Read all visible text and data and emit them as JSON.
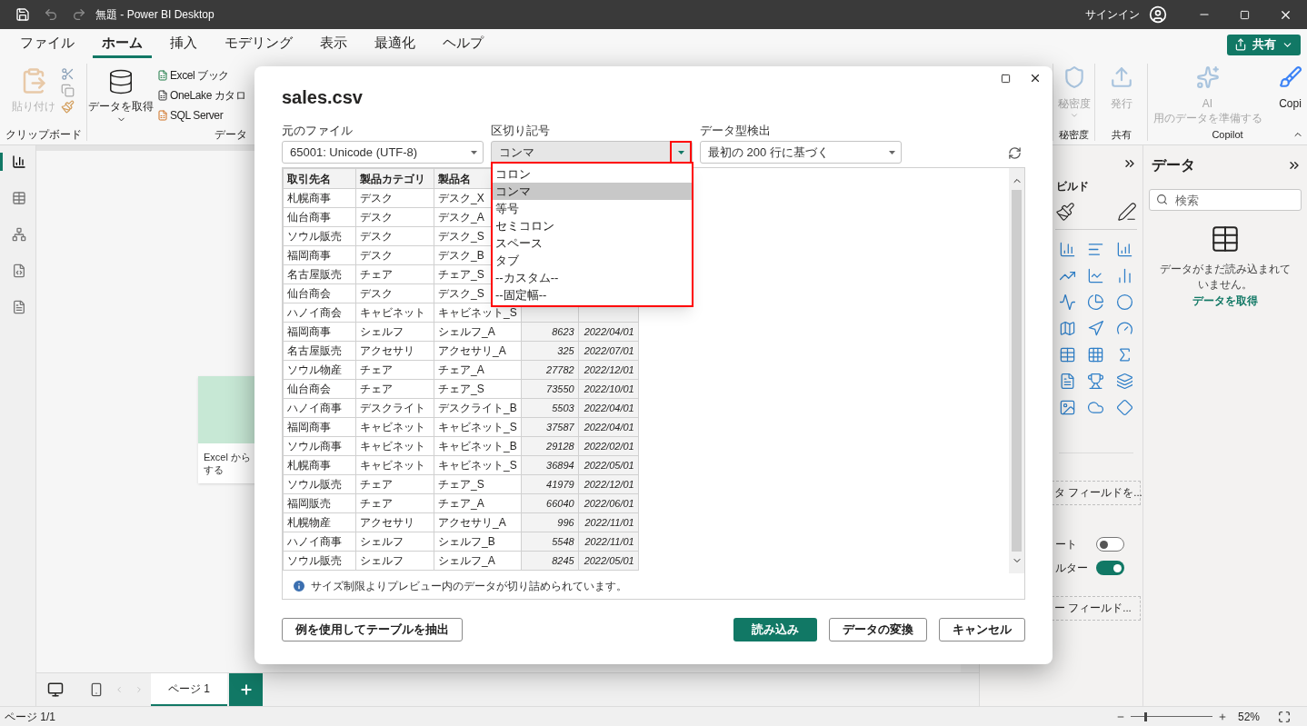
{
  "window": {
    "title": "無題 - Power BI Desktop",
    "signin": "サインイン"
  },
  "menu_tabs": [
    {
      "label": "ファイル",
      "selected": false
    },
    {
      "label": "ホーム",
      "selected": true
    },
    {
      "label": "挿入",
      "selected": false
    },
    {
      "label": "モデリング",
      "selected": false
    },
    {
      "label": "表示",
      "selected": false
    },
    {
      "label": "最適化",
      "selected": false
    },
    {
      "label": "ヘルプ",
      "selected": false
    }
  ],
  "share_button": "共有",
  "ribbon": {
    "clipboard": {
      "paste": "貼り付け",
      "paste_disabled": true,
      "group": "クリップボード"
    },
    "data": {
      "get_data": "データを取得",
      "sources": [
        "Excel ブック",
        "OneLake カタロ",
        "SQL Server"
      ],
      "group": "データ"
    },
    "right_groups": [
      {
        "label": "秘密度",
        "buttons": [
          {
            "label": "秘密度",
            "disabled": true
          }
        ]
      },
      {
        "label": "共有",
        "buttons": [
          {
            "label": "発行",
            "disabled": true
          }
        ]
      },
      {
        "label": "Copilot",
        "buttons": [
          {
            "label": "AI\n用のデータを準備する",
            "disabled": true
          },
          {
            "label": "Copi",
            "disabled": false
          }
        ]
      }
    ]
  },
  "nav": [
    {
      "kind": "report",
      "selected": true
    },
    {
      "kind": "table",
      "selected": false
    },
    {
      "kind": "model",
      "selected": false
    },
    {
      "kind": "dax",
      "selected": false
    },
    {
      "kind": "tmdl",
      "selected": false
    }
  ],
  "canvas": {
    "card_lines": [
      "Excel から",
      "する"
    ]
  },
  "pages": [
    {
      "label": "ページ 1",
      "selected": true
    }
  ],
  "status_bar": {
    "page": "ページ 1/1",
    "zoom": "52%",
    "zoom_slider": {
      "level": 0.17
    }
  },
  "visualizations": {
    "build_label": "ビルド",
    "field_well_1": "タ フィールドを...",
    "toggles": [
      {
        "label": "ート",
        "on": false
      },
      {
        "label": "ルター",
        "on": true
      }
    ],
    "field_well_2": "ー フィールド..."
  },
  "data_pane": {
    "title": "データ",
    "search_placeholder": "検索",
    "empty_message": "データがまだ読み込まれていません。",
    "link": "データを取得"
  },
  "dialog": {
    "title": "sales.csv",
    "file_origin": {
      "label": "元のファイル",
      "value": "65001: Unicode (UTF-8)"
    },
    "delimiter": {
      "label": "区切り記号",
      "value": "コンマ",
      "expanded": true,
      "highlighted": true,
      "options": [
        {
          "label": "コロン",
          "selected": false
        },
        {
          "label": "コンマ",
          "selected": true
        },
        {
          "label": "等号",
          "selected": false
        },
        {
          "label": "セミコロン",
          "selected": false
        },
        {
          "label": "スペース",
          "selected": false
        },
        {
          "label": "タブ",
          "selected": false
        },
        {
          "label": "--カスタム--",
          "selected": false
        },
        {
          "label": "--固定幅--",
          "selected": false
        }
      ]
    },
    "type_detection": {
      "label": "データ型検出",
      "value": "最初の 200 行に基づく"
    },
    "table": {
      "columns": [
        "取引先名",
        "製品カテゴリ",
        "製品名"
      ],
      "rows": [
        {
          "cells": [
            "札幌商事",
            "デスク",
            "デスク_X"
          ]
        },
        {
          "cells": [
            "仙台商事",
            "デスク",
            "デスク_A"
          ]
        },
        {
          "cells": [
            "ソウル販売",
            "デスク",
            "デスク_S"
          ]
        },
        {
          "cells": [
            "福岡商事",
            "デスク",
            "デスク_B"
          ]
        },
        {
          "cells": [
            "名古屋販売",
            "チェア",
            "チェア_S"
          ]
        },
        {
          "cells": [
            "仙台商会",
            "デスク",
            "デスク_S"
          ]
        },
        {
          "cells": [
            "ハノイ商会",
            "キャビネット",
            "キャビネット_S"
          ]
        },
        {
          "cells": [
            "福岡商事",
            "シェルフ",
            "シェルフ_A",
            "8623",
            "2022/04/01"
          ]
        },
        {
          "cells": [
            "名古屋販売",
            "アクセサリ",
            "アクセサリ_A",
            "325",
            "2022/07/01"
          ]
        },
        {
          "cells": [
            "ソウル物産",
            "チェア",
            "チェア_A",
            "27782",
            "2022/12/01"
          ]
        },
        {
          "cells": [
            "仙台商会",
            "チェア",
            "チェア_S",
            "73550",
            "2022/10/01"
          ]
        },
        {
          "cells": [
            "ハノイ商事",
            "デスクライト",
            "デスクライト_B",
            "5503",
            "2022/04/01"
          ]
        },
        {
          "cells": [
            "福岡商事",
            "キャビネット",
            "キャビネット_S",
            "37587",
            "2022/04/01"
          ]
        },
        {
          "cells": [
            "ソウル商事",
            "キャビネット",
            "キャビネット_B",
            "29128",
            "2022/02/01"
          ]
        },
        {
          "cells": [
            "札幌商事",
            "キャビネット",
            "キャビネット_S",
            "36894",
            "2022/05/01"
          ]
        },
        {
          "cells": [
            "ソウル販売",
            "チェア",
            "チェア_S",
            "41979",
            "2022/12/01"
          ]
        },
        {
          "cells": [
            "福岡販売",
            "チェア",
            "チェア_A",
            "66040",
            "2022/06/01"
          ]
        },
        {
          "cells": [
            "札幌物産",
            "アクセサリ",
            "アクセサリ_A",
            "996",
            "2022/11/01"
          ]
        },
        {
          "cells": [
            "ハノイ商事",
            "シェルフ",
            "シェルフ_B",
            "5548",
            "2022/11/01"
          ]
        },
        {
          "cells": [
            "ソウル販売",
            "シェルフ",
            "シェルフ_A",
            "8245",
            "2022/05/01"
          ]
        }
      ]
    },
    "note": "サイズ制限よりプレビュー内のデータが切り詰められています。",
    "buttons": [
      {
        "label": "例を使用してテーブルを抽出",
        "kind": "secondary"
      },
      {
        "label": "読み込み",
        "kind": "primary"
      },
      {
        "label": "データの変換",
        "kind": "secondary"
      },
      {
        "label": "キャンセル",
        "kind": "secondary"
      }
    ]
  }
}
